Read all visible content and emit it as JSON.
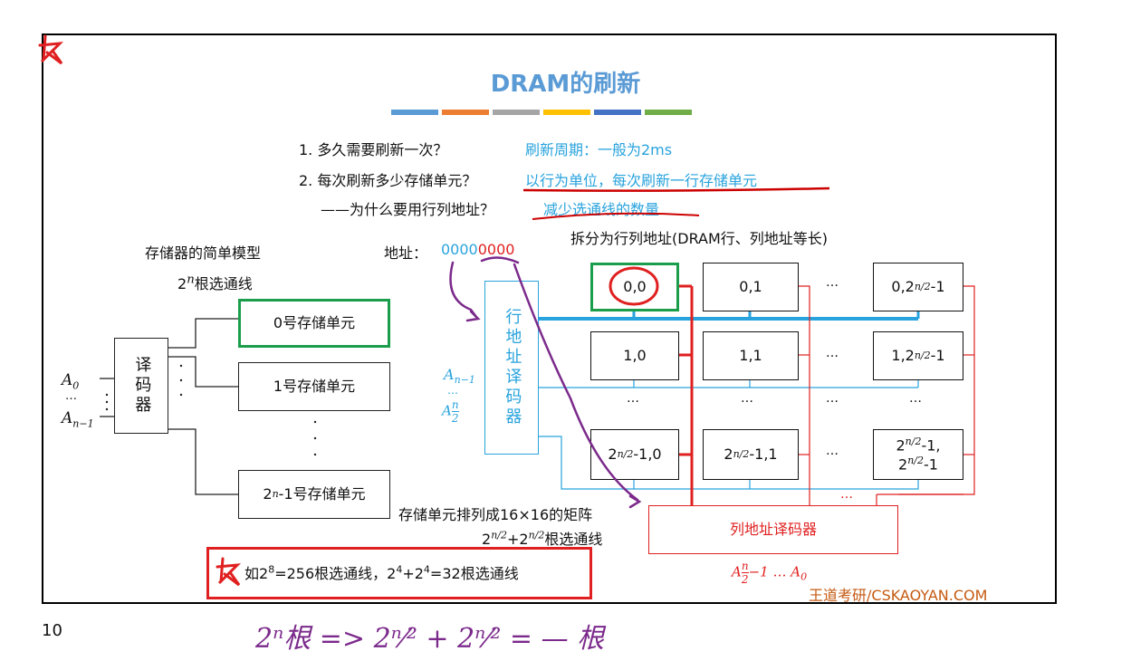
{
  "slide": {
    "title": "DRAM的刷新",
    "title_bar_colors": [
      "#5b9bd5",
      "#ed7d31",
      "#a5a5a5",
      "#ffc000",
      "#4472c4",
      "#70ad47"
    ],
    "q1_text": "1. 多久需要刷新一次？",
    "q1_answer": "刷新周期：一般为2ms",
    "q2_text": "2. 每次刷新多少存储单元？",
    "q2_answer": "以行为单位，每次刷新一行存储单元",
    "q3_text": "——为什么要用行列地址？",
    "q3_answer": "减少选通线的数量",
    "page_number": "10",
    "watermark": "王道考研/CSKAOYAN.COM"
  },
  "left_model": {
    "heading": "存储器的简单模型",
    "lines_label": "根选通线",
    "lines_base": "2",
    "lines_exp": "n",
    "decoder_label": "译码器",
    "addr_top": "A",
    "addr_top_sub": "0",
    "addr_bottom": "A",
    "addr_bottom_sub": "n−1",
    "cells": [
      "0号存储单元",
      "1号存储单元",
      "号存储单元"
    ],
    "last_cell_prefix": "2",
    "last_cell_exp": "n",
    "last_cell_suffix": "-1"
  },
  "address": {
    "label": "地址：",
    "row_bits": "0000",
    "col_bits": "0000",
    "split_label": "拆分为行列地址(DRAM行、列地址等长)"
  },
  "row_decoder": {
    "label": "行地址译码器",
    "addr_top": "A",
    "addr_top_sub": "n−1",
    "addr_bottom_num": "n",
    "addr_bottom_den": "2"
  },
  "matrix": {
    "row0": [
      "0,0",
      "0,1",
      "…",
      "0,2"
    ],
    "row1": [
      "1,0",
      "1,1",
      "…",
      "1,2"
    ],
    "exp": "n/2",
    "suffix": "-1",
    "row_last_c0": ",0",
    "row_last_c1": ",1",
    "last_line1": ",",
    "last_line2": "-1",
    "ellipsis": "…"
  },
  "col_decoder": {
    "label": "列地址译码器",
    "addr_mid": "−1 … A",
    "addr_last_sub": "0"
  },
  "notes": {
    "matrix_note": "存储单元排列成16×16的矩阵",
    "lines_suffix": "根选通线",
    "plus": "+",
    "example_prefix": "如2",
    "example_exp1": "8",
    "example_mid1": "=256根选通线，2",
    "example_exp2": "4",
    "example_mid2": "+2",
    "example_exp3": "4",
    "example_end": "=32根选通线"
  },
  "handwriting": {
    "line": "2ⁿ根 => 2ⁿ⁄² + 2ⁿ⁄² = — 根"
  }
}
